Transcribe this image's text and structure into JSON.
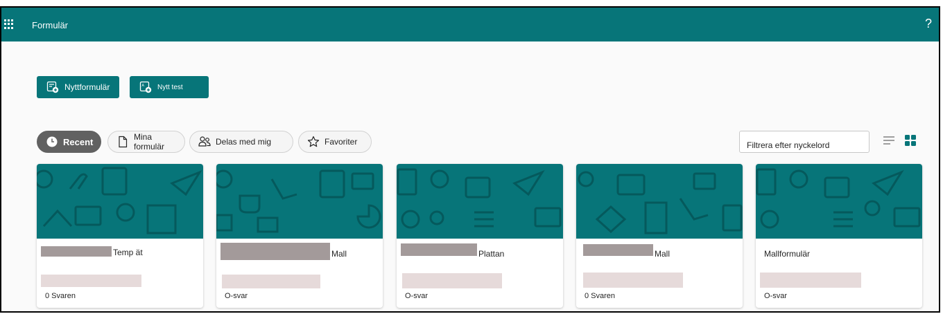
{
  "header": {
    "app_title": "Formulär",
    "help": "?"
  },
  "actions": {
    "new_form": "Nyttformulär",
    "new_test": "Nytt test"
  },
  "tabs": [
    {
      "label": "Recent",
      "icon": "clock-icon",
      "selected": true
    },
    {
      "label": "Mina formulär",
      "icon": "document-icon",
      "selected": false
    },
    {
      "label": "Delas med mig",
      "icon": "people-icon",
      "selected": false
    },
    {
      "label": "Favoriter",
      "icon": "star-icon",
      "selected": false
    }
  ],
  "filter": {
    "placeholder": "Filtrera efter nyckelord"
  },
  "colors": {
    "brand": "#077579",
    "selected_tab": "#616161",
    "accent_grid": "#077579"
  },
  "cards": [
    {
      "title": "Temp ät",
      "responses": "0 Svaren"
    },
    {
      "title": "Mall",
      "responses": "O-svar"
    },
    {
      "title": "Plattan",
      "responses": "O-svar"
    },
    {
      "title": "Mall",
      "responses": "0 Svaren"
    },
    {
      "title": "Mallformulär",
      "responses": "O-svar"
    }
  ]
}
